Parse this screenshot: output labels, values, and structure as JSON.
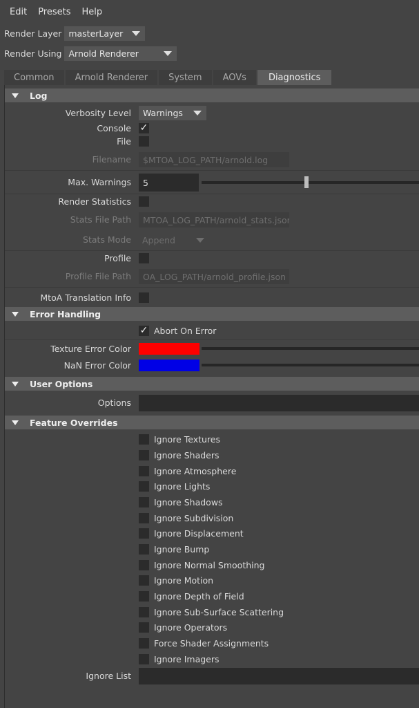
{
  "menu": [
    "Edit",
    "Presets",
    "Help"
  ],
  "render_layer": {
    "label": "Render Layer",
    "value": "masterLayer"
  },
  "render_using": {
    "label": "Render Using",
    "value": "Arnold Renderer"
  },
  "tabs": [
    "Common",
    "Arnold Renderer",
    "System",
    "AOVs",
    "Diagnostics"
  ],
  "active_tab": "Diagnostics",
  "log": {
    "header": "Log",
    "verbosity_label": "Verbosity Level",
    "verbosity_value": "Warnings",
    "console_label": "Console",
    "console_checked": true,
    "file_label": "File",
    "file_checked": false,
    "filename_label": "Filename",
    "filename_value": "$MTOA_LOG_PATH/arnold.log",
    "max_warnings_label": "Max. Warnings",
    "max_warnings_value": "5",
    "max_warnings_slider_fraction": 0.47,
    "render_stats_label": "Render Statistics",
    "render_stats_checked": false,
    "stats_path_label": "Stats File Path",
    "stats_path_value": "MTOA_LOG_PATH/arnold_stats.json",
    "stats_mode_label": "Stats Mode",
    "stats_mode_value": "Append",
    "profile_label": "Profile",
    "profile_checked": false,
    "profile_path_label": "Profile File Path",
    "profile_path_value": "OA_LOG_PATH/arnold_profile.json",
    "mtoa_translation_label": "MtoA Translation Info",
    "mtoa_translation_checked": false
  },
  "error_handling": {
    "header": "Error Handling",
    "abort_label": "Abort On Error",
    "abort_checked": true,
    "texture_error_label": "Texture Error Color",
    "texture_error_color": "#ff0000",
    "nan_error_label": "NaN Error Color",
    "nan_error_color": "#0000e6"
  },
  "user_options": {
    "header": "User Options",
    "options_label": "Options",
    "options_value": ""
  },
  "feature_overrides": {
    "header": "Feature Overrides",
    "items": [
      "Ignore Textures",
      "Ignore Shaders",
      "Ignore Atmosphere",
      "Ignore Lights",
      "Ignore Shadows",
      "Ignore Subdivision",
      "Ignore Displacement",
      "Ignore Bump",
      "Ignore Normal Smoothing",
      "Ignore Motion",
      "Ignore Depth of Field",
      "Ignore Sub-Surface Scattering",
      "Ignore Operators",
      "Force Shader Assignments",
      "Ignore Imagers"
    ],
    "ignore_list_label": "Ignore List",
    "ignore_list_value": ""
  }
}
